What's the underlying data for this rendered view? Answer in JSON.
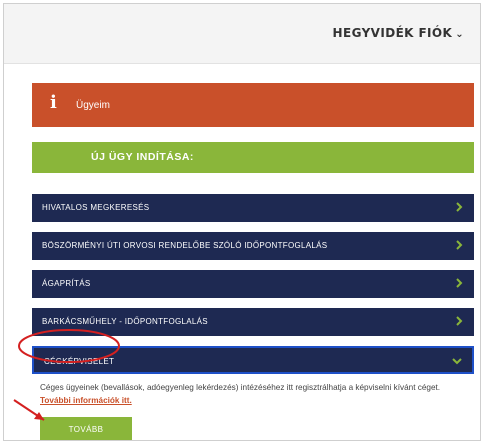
{
  "header": {
    "account_label": "HEGYVIDÉK FIÓK",
    "account_caret": "⌄"
  },
  "my_cases": {
    "icon": "info-icon",
    "icon_glyph": "i",
    "label": "Ügyeim",
    "color": "#c9502a"
  },
  "new_case": {
    "label": "ÚJ ÜGY INDÍTÁSA:",
    "color": "#8ab63a"
  },
  "menu": {
    "items": [
      {
        "label": "HIVATALOS MEGKERESÉS"
      },
      {
        "label": "BÖSZÖRMÉNYI ÚTI ORVOSI RENDELŐBE SZÓLÓ IDŐPONTFOGLALÁS"
      },
      {
        "label": "ÁGAPRÍTÁS"
      },
      {
        "label": "BARKÁCSMŰHELY - IDŐPONTFOGLALÁS"
      },
      {
        "label": "CÉGKÉPVISELET"
      }
    ],
    "color": "#1e2952",
    "chevron_color": "#8ab63a"
  },
  "expanded": {
    "description": "Céges ügyeinek (bevallások, adóegyenleg lekérdezés) intézéséhez itt regisztrálhatja a képviselni kívánt céget.",
    "link": "További információk itt.",
    "button": "TOVÁBB"
  },
  "annotation_color": "#d42020"
}
